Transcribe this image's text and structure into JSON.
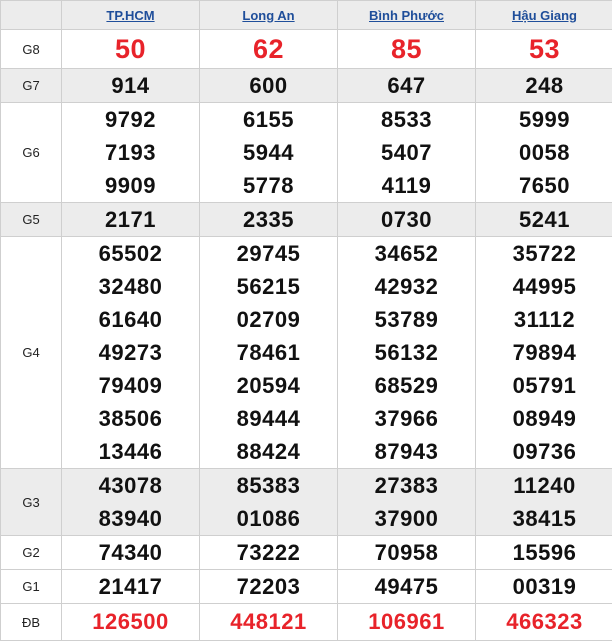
{
  "provinces": [
    "TP.HCM",
    "Long An",
    "Bình Phước",
    "Hậu Giang"
  ],
  "colors": {
    "header_bg": "#ececec",
    "link": "#1f4e9a",
    "highlight": "#e8232a",
    "grid": "#cfcfcf"
  },
  "prizes": [
    {
      "label": "G8",
      "shade": false,
      "results": [
        [
          "50"
        ],
        [
          "62"
        ],
        [
          "85"
        ],
        [
          "53"
        ]
      ]
    },
    {
      "label": "G7",
      "shade": true,
      "results": [
        [
          "914"
        ],
        [
          "600"
        ],
        [
          "647"
        ],
        [
          "248"
        ]
      ]
    },
    {
      "label": "G6",
      "shade": false,
      "results": [
        [
          "9792",
          "7193",
          "9909"
        ],
        [
          "6155",
          "5944",
          "5778"
        ],
        [
          "8533",
          "5407",
          "4119"
        ],
        [
          "5999",
          "0058",
          "7650"
        ]
      ]
    },
    {
      "label": "G5",
      "shade": true,
      "results": [
        [
          "2171"
        ],
        [
          "2335"
        ],
        [
          "0730"
        ],
        [
          "5241"
        ]
      ]
    },
    {
      "label": "G4",
      "shade": false,
      "results": [
        [
          "65502",
          "32480",
          "61640",
          "49273",
          "79409",
          "38506",
          "13446"
        ],
        [
          "29745",
          "56215",
          "02709",
          "78461",
          "20594",
          "89444",
          "88424"
        ],
        [
          "34652",
          "42932",
          "53789",
          "56132",
          "68529",
          "37966",
          "87943"
        ],
        [
          "35722",
          "44995",
          "31112",
          "79894",
          "05791",
          "08949",
          "09736"
        ]
      ]
    },
    {
      "label": "G3",
      "shade": true,
      "results": [
        [
          "43078",
          "83940"
        ],
        [
          "85383",
          "01086"
        ],
        [
          "27383",
          "37900"
        ],
        [
          "11240",
          "38415"
        ]
      ]
    },
    {
      "label": "G2",
      "shade": false,
      "results": [
        [
          "74340"
        ],
        [
          "73222"
        ],
        [
          "70958"
        ],
        [
          "15596"
        ]
      ]
    },
    {
      "label": "G1",
      "shade": false,
      "results": [
        [
          "21417"
        ],
        [
          "72203"
        ],
        [
          "49475"
        ],
        [
          "00319"
        ]
      ]
    },
    {
      "label": "ĐB",
      "shade": false,
      "results": [
        [
          "126500"
        ],
        [
          "448121"
        ],
        [
          "106961"
        ],
        [
          "466323"
        ]
      ]
    }
  ]
}
